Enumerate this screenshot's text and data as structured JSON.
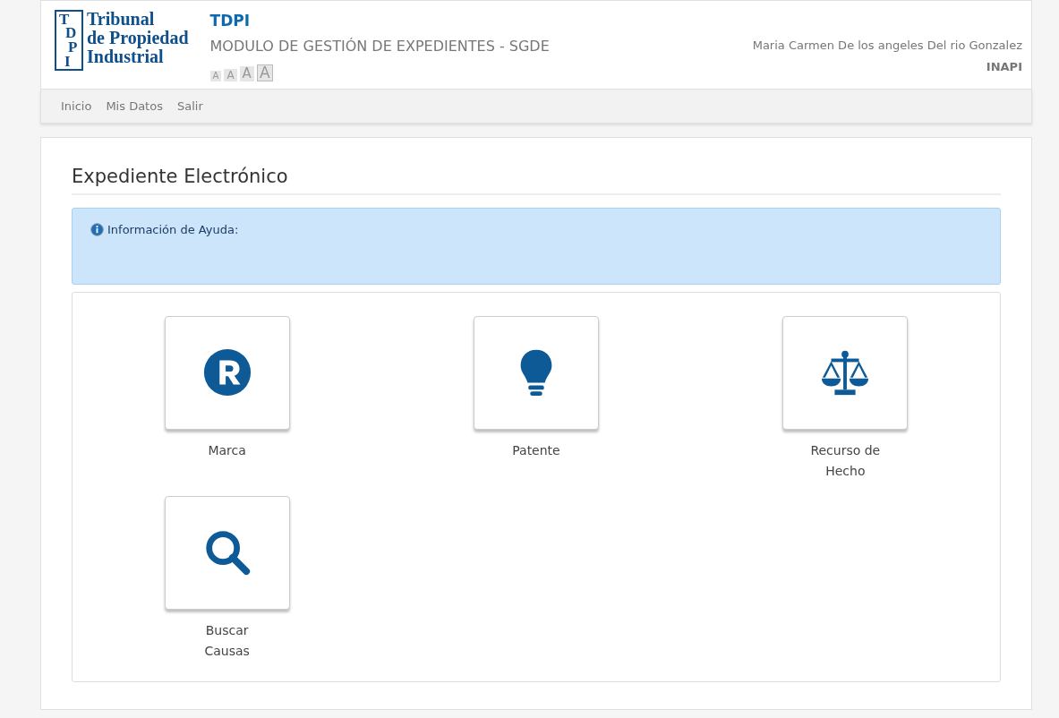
{
  "header": {
    "logo": {
      "letters": [
        "T",
        "D",
        "P",
        "I"
      ],
      "lines": [
        "Tribunal",
        "de Propiedad",
        "Industrial"
      ]
    },
    "app_name": "TDPI",
    "app_subtitle": "MODULO DE GESTIÓN DE EXPEDIENTES - SGDE",
    "font_sizes": [
      {
        "label": "A",
        "selected": false
      },
      {
        "label": "A",
        "selected": false
      },
      {
        "label": "A",
        "selected": false
      },
      {
        "label": "A",
        "selected": true
      }
    ],
    "user_name": "Maria Carmen De los angeles Del rio Gonzalez",
    "organization": "INAPI"
  },
  "nav": [
    "Inicio",
    "Mis Datos",
    "Salir"
  ],
  "page_title": "Expediente Electrónico",
  "help": {
    "text": "Información de Ayuda:"
  },
  "tiles": [
    {
      "kind": "registered",
      "label": "Marca"
    },
    {
      "kind": "bulb",
      "label": "Patente"
    },
    {
      "kind": "scale",
      "label": "Recurso de Hecho"
    },
    {
      "kind": "search",
      "label": "Buscar Causas"
    }
  ]
}
